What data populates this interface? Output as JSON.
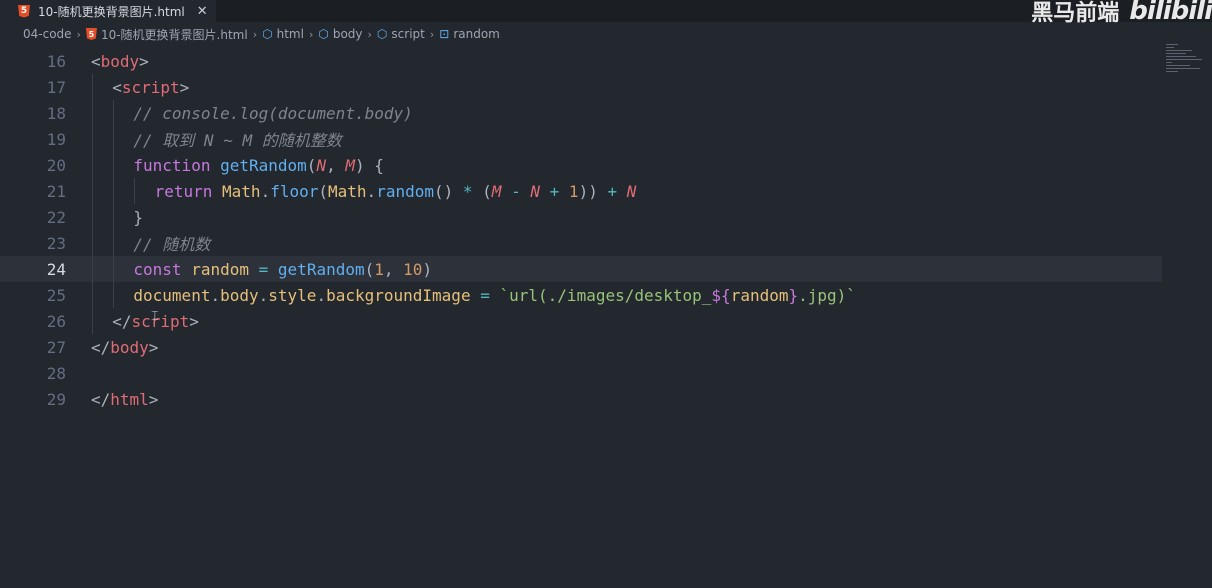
{
  "tab": {
    "icon": "html5-icon",
    "title": "10-随机更换背景图片.html",
    "close": "✕"
  },
  "watermark": {
    "brand": "黑马前端",
    "site": "bilibili"
  },
  "breadcrumb": [
    {
      "label": "04-code",
      "icon": ""
    },
    {
      "label": "10-随机更换背景图片.html",
      "icon": "html5-icon"
    },
    {
      "label": "html",
      "icon": "cube-icon"
    },
    {
      "label": "body",
      "icon": "cube-icon"
    },
    {
      "label": "script",
      "icon": "cube-icon"
    },
    {
      "label": "random",
      "icon": "variable-icon"
    }
  ],
  "editor": {
    "current_line": 24,
    "lines": [
      {
        "n": "16",
        "indent": 0,
        "tokens": [
          [
            "t-punc",
            "<"
          ],
          [
            "t-tag",
            "body"
          ],
          [
            "t-punc",
            ">"
          ]
        ]
      },
      {
        "n": "17",
        "indent": 1,
        "tokens": [
          [
            "t-punc",
            "<"
          ],
          [
            "t-tag",
            "script"
          ],
          [
            "t-punc",
            ">"
          ]
        ]
      },
      {
        "n": "18",
        "indent": 2,
        "tokens": [
          [
            "t-cmt",
            "// console.log(document.body)"
          ]
        ]
      },
      {
        "n": "19",
        "indent": 2,
        "tokens": [
          [
            "t-cmt",
            "// 取到 N ~ M 的随机整数"
          ]
        ]
      },
      {
        "n": "20",
        "indent": 2,
        "tokens": [
          [
            "t-kw",
            "function"
          ],
          [
            "t-plain",
            " "
          ],
          [
            "t-fn",
            "getRandom"
          ],
          [
            "t-punc",
            "("
          ],
          [
            "t-param",
            "N"
          ],
          [
            "t-punc",
            ", "
          ],
          [
            "t-param",
            "M"
          ],
          [
            "t-punc",
            ") {"
          ]
        ]
      },
      {
        "n": "21",
        "indent": 3,
        "tokens": [
          [
            "t-kw",
            "return"
          ],
          [
            "t-plain",
            " "
          ],
          [
            "t-var",
            "Math"
          ],
          [
            "t-punc",
            "."
          ],
          [
            "t-fn",
            "floor"
          ],
          [
            "t-punc",
            "("
          ],
          [
            "t-var",
            "Math"
          ],
          [
            "t-punc",
            "."
          ],
          [
            "t-fn",
            "random"
          ],
          [
            "t-punc",
            "() "
          ],
          [
            "t-op",
            "*"
          ],
          [
            "t-punc",
            " ("
          ],
          [
            "t-param",
            "M"
          ],
          [
            "t-punc",
            " "
          ],
          [
            "t-op",
            "-"
          ],
          [
            "t-punc",
            " "
          ],
          [
            "t-param",
            "N"
          ],
          [
            "t-punc",
            " "
          ],
          [
            "t-op",
            "+"
          ],
          [
            "t-punc",
            " "
          ],
          [
            "t-num",
            "1"
          ],
          [
            "t-punc",
            ")) "
          ],
          [
            "t-op",
            "+"
          ],
          [
            "t-punc",
            " "
          ],
          [
            "t-param",
            "N"
          ]
        ]
      },
      {
        "n": "22",
        "indent": 2,
        "tokens": [
          [
            "t-punc",
            "}"
          ]
        ]
      },
      {
        "n": "23",
        "indent": 2,
        "tokens": [
          [
            "t-cmt",
            "// 随机数"
          ]
        ]
      },
      {
        "n": "24",
        "indent": 2,
        "tokens": [
          [
            "t-kw",
            "const"
          ],
          [
            "t-plain",
            " "
          ],
          [
            "t-var",
            "random"
          ],
          [
            "t-plain",
            " "
          ],
          [
            "t-op",
            "="
          ],
          [
            "t-plain",
            " "
          ],
          [
            "t-fn",
            "getRandom"
          ],
          [
            "t-punc",
            "("
          ],
          [
            "t-num",
            "1"
          ],
          [
            "t-punc",
            ", "
          ],
          [
            "t-num",
            "10"
          ],
          [
            "t-punc",
            ")"
          ]
        ]
      },
      {
        "n": "25",
        "indent": 2,
        "tokens": [
          [
            "t-var",
            "document"
          ],
          [
            "t-punc",
            "."
          ],
          [
            "t-var",
            "body"
          ],
          [
            "t-punc",
            "."
          ],
          [
            "t-var",
            "style"
          ],
          [
            "t-punc",
            "."
          ],
          [
            "t-var",
            "backgroundImage"
          ],
          [
            "t-plain",
            " "
          ],
          [
            "t-op",
            "="
          ],
          [
            "t-plain",
            " "
          ],
          [
            "t-str",
            "`url(./images/desktop_"
          ],
          [
            "t-tmpl",
            "${"
          ],
          [
            "t-var",
            "random"
          ],
          [
            "t-tmpl",
            "}"
          ],
          [
            "t-str",
            ".jpg)`"
          ]
        ]
      },
      {
        "n": "26",
        "indent": 1,
        "tokens": [
          [
            "t-punc",
            "</"
          ],
          [
            "t-tag",
            "script"
          ],
          [
            "t-punc",
            ">"
          ]
        ]
      },
      {
        "n": "27",
        "indent": 0,
        "tokens": [
          [
            "t-punc",
            "</"
          ],
          [
            "t-tag",
            "body"
          ],
          [
            "t-punc",
            ">"
          ]
        ]
      },
      {
        "n": "28",
        "indent": 0,
        "tokens": []
      },
      {
        "n": "29",
        "indent": 0,
        "tokens": [
          [
            "t-punc",
            "</"
          ],
          [
            "t-tag",
            "html"
          ],
          [
            "t-punc",
            ">"
          ]
        ]
      }
    ]
  },
  "colors": {
    "background": "#23272e",
    "current_line": "#2c313a",
    "tag": "#e06c75",
    "keyword": "#c678dd",
    "function": "#61afef",
    "string": "#98c379",
    "number": "#d19a66",
    "comment": "#7f848e"
  }
}
